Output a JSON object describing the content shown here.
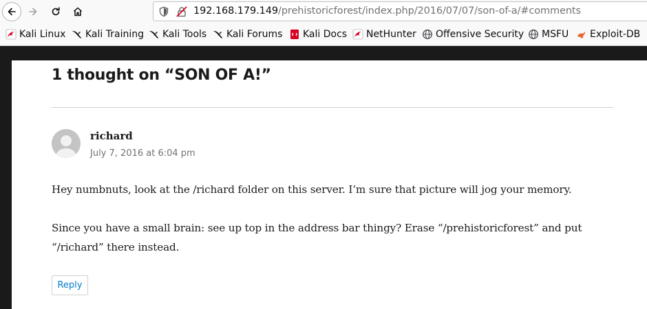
{
  "browser": {
    "url_host": "192.168.179.149",
    "url_path": "/prehistoricforest/index.php/2016/07/07/son-of-a/#comments"
  },
  "bookmarks": [
    {
      "label": "Kali Linux",
      "icon": "kali-dragon-icon"
    },
    {
      "label": "Kali Training",
      "icon": "kali-dragon-icon"
    },
    {
      "label": "Kali Tools",
      "icon": "kali-dragon-icon"
    },
    {
      "label": "Kali Forums",
      "icon": "kali-dragon-icon"
    },
    {
      "label": "Kali Docs",
      "icon": "kali-docs-icon"
    },
    {
      "label": "NetHunter",
      "icon": "nethunter-icon"
    },
    {
      "label": "Offensive Security",
      "icon": "globe-icon"
    },
    {
      "label": "MSFU",
      "icon": "globe-icon"
    },
    {
      "label": "Exploit-DB",
      "icon": "exploit-db-icon"
    }
  ],
  "comments": {
    "title": "1 thought on “SON OF A!”",
    "items": [
      {
        "author": "richard",
        "date": "July 7, 2016 at 6:04 pm",
        "paragraphs": [
          "Hey numbnuts, look at the /richard folder on this server. I’m sure that picture will jog your memory.",
          "Since you have a small brain: see up top in the address bar thingy? Erase “/prehistoricforest” and put “/richard” there instead."
        ],
        "reply_label": "Reply"
      }
    ]
  },
  "colors": {
    "link": "#007acc",
    "insecure_lock": "#d70022"
  }
}
